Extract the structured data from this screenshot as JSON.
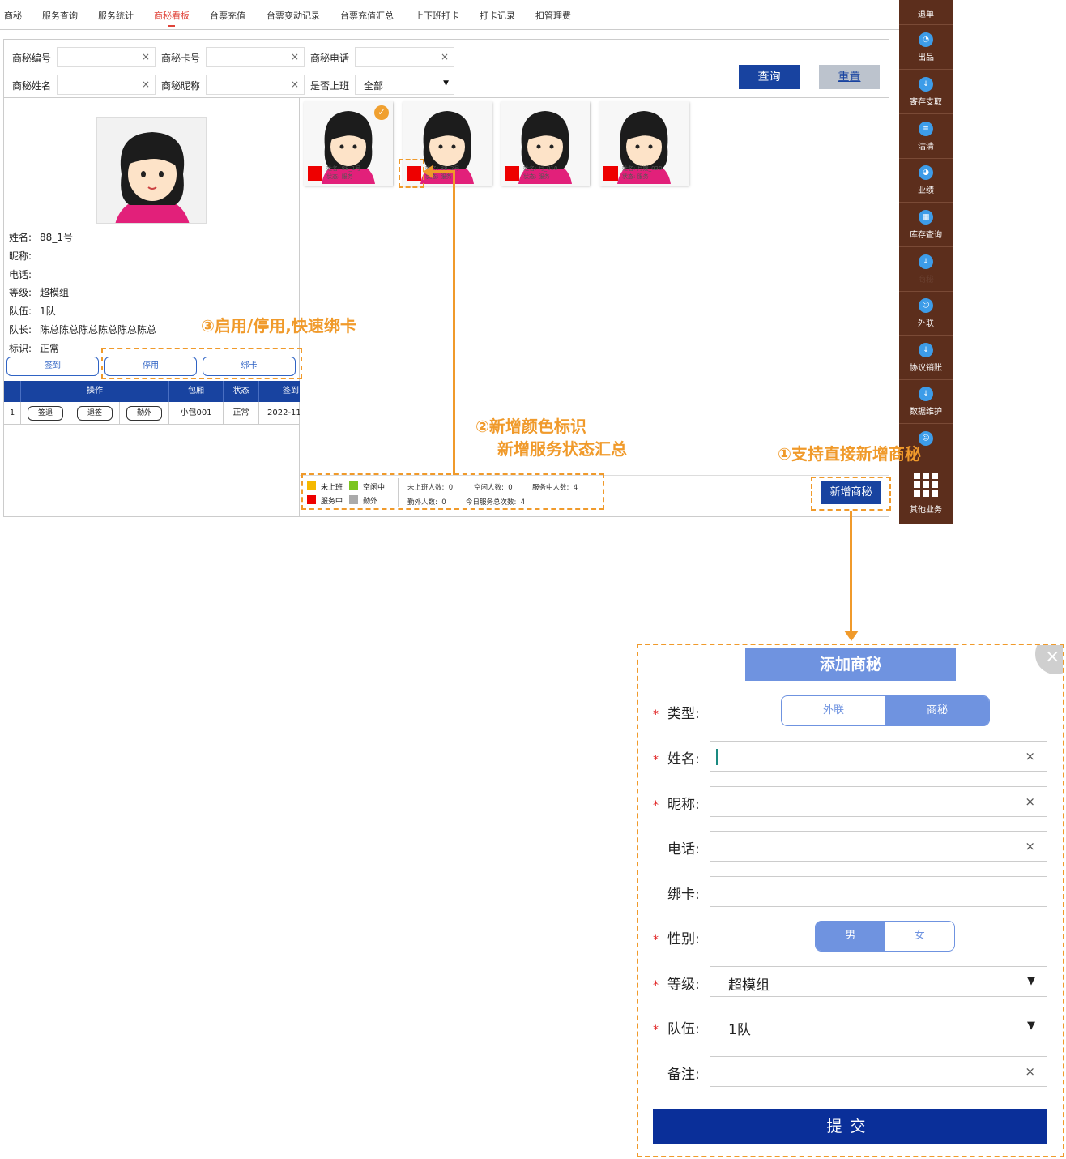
{
  "nav": {
    "tabs": [
      "商秘",
      "服务查询",
      "服务统计",
      "商秘看板",
      "台票充值",
      "台票变动记录",
      "台票充值汇总",
      "上下班打卡",
      "打卡记录",
      "扣管理费"
    ],
    "active": "商秘看板"
  },
  "search": {
    "code_label": "商秘编号",
    "card_label": "商秘卡号",
    "phone_label": "商秘电话",
    "name_label": "商秘姓名",
    "nick_label": "商秘昵称",
    "onduty_label": "是否上班",
    "onduty_value": "全部",
    "clear": "×",
    "arrow": "▼",
    "query": "查询",
    "reset": "重置"
  },
  "detail": {
    "name_label": "姓名:",
    "name": "88_1号",
    "nick_label": "昵称:",
    "phone_label": "电话:",
    "level_label": "等级:",
    "level": "超模组",
    "team_label": "队伍:",
    "team": "1队",
    "leader_label": "队长:",
    "leader": "陈总陈总陈总陈总陈总陈总",
    "flag_label": "标识:",
    "flag": "正常",
    "btn_checkin": "签到",
    "btn_disable": "停用",
    "btn_bind": "绑卡"
  },
  "table": {
    "headers": [
      "操作",
      "包厢",
      "状态",
      "签到"
    ],
    "row": {
      "index": "1",
      "b1": "签退",
      "b2": "退签",
      "b3": "勤外",
      "room": "小包001",
      "status": "正常",
      "time": "2022-11-"
    }
  },
  "cards": [
    {
      "name": "88_1号",
      "name_label": "姓名:",
      "state_label": "状态:",
      "state": "服务"
    },
    {
      "name": "88_2号",
      "name_label": "姓名:",
      "state_label": "状态:",
      "state": "服务"
    },
    {
      "name": "月_010",
      "name_label": "姓名:",
      "state_label": "状态:",
      "state": "服务"
    },
    {
      "name": "月嫂_020",
      "name_label": "姓名:",
      "state_label": "状态:",
      "state": "服务"
    }
  ],
  "check_mark": "✓",
  "legend": {
    "off": "未上班",
    "idle": "空闲中",
    "serving": "服务中",
    "out": "勤外",
    "colors": {
      "off": "#f5b800",
      "idle": "#7cc520",
      "serving": "#ee0000",
      "out": "#aaaaaa"
    }
  },
  "stats": {
    "off_label": "未上班人数:",
    "off": "0",
    "idle_label": "空闲人数:",
    "idle": "0",
    "serving_label": "服务中人数:",
    "serving": "4",
    "out_label": "勤外人数:",
    "out": "0",
    "today_label": "今日服务总次数:",
    "today": "4"
  },
  "add_button": "新增商秘",
  "sidebar": [
    "退单",
    "出品",
    "寄存支取",
    "沽清",
    "业绩",
    "库存查询",
    "商秘",
    "外联",
    "协议销账",
    "数据维护",
    "其他业务"
  ],
  "annotations": {
    "a1": "①支持直接新增商秘",
    "a2_line1": "②新增颜色标识",
    "a2_line2": "新增服务状态汇总",
    "a3": "③启用/停用,快速绑卡"
  },
  "dialog": {
    "title": "添加商秘",
    "close": "×",
    "req": "*",
    "type_label": "类型:",
    "type_opt1": "外联",
    "type_opt2": "商秘",
    "name_label": "姓名:",
    "nick_label": "昵称:",
    "phone_label": "电话:",
    "card_label": "绑卡:",
    "gender_label": "性别:",
    "gender_male": "男",
    "gender_female": "女",
    "level_label": "等级:",
    "level_value": "超模组",
    "team_label": "队伍:",
    "team_value": "1队",
    "remark_label": "备注:",
    "submit": "提交",
    "clear": "×",
    "arrow": "▼"
  },
  "accent_color": "#f09a2b",
  "brand_color": "#1843a0"
}
